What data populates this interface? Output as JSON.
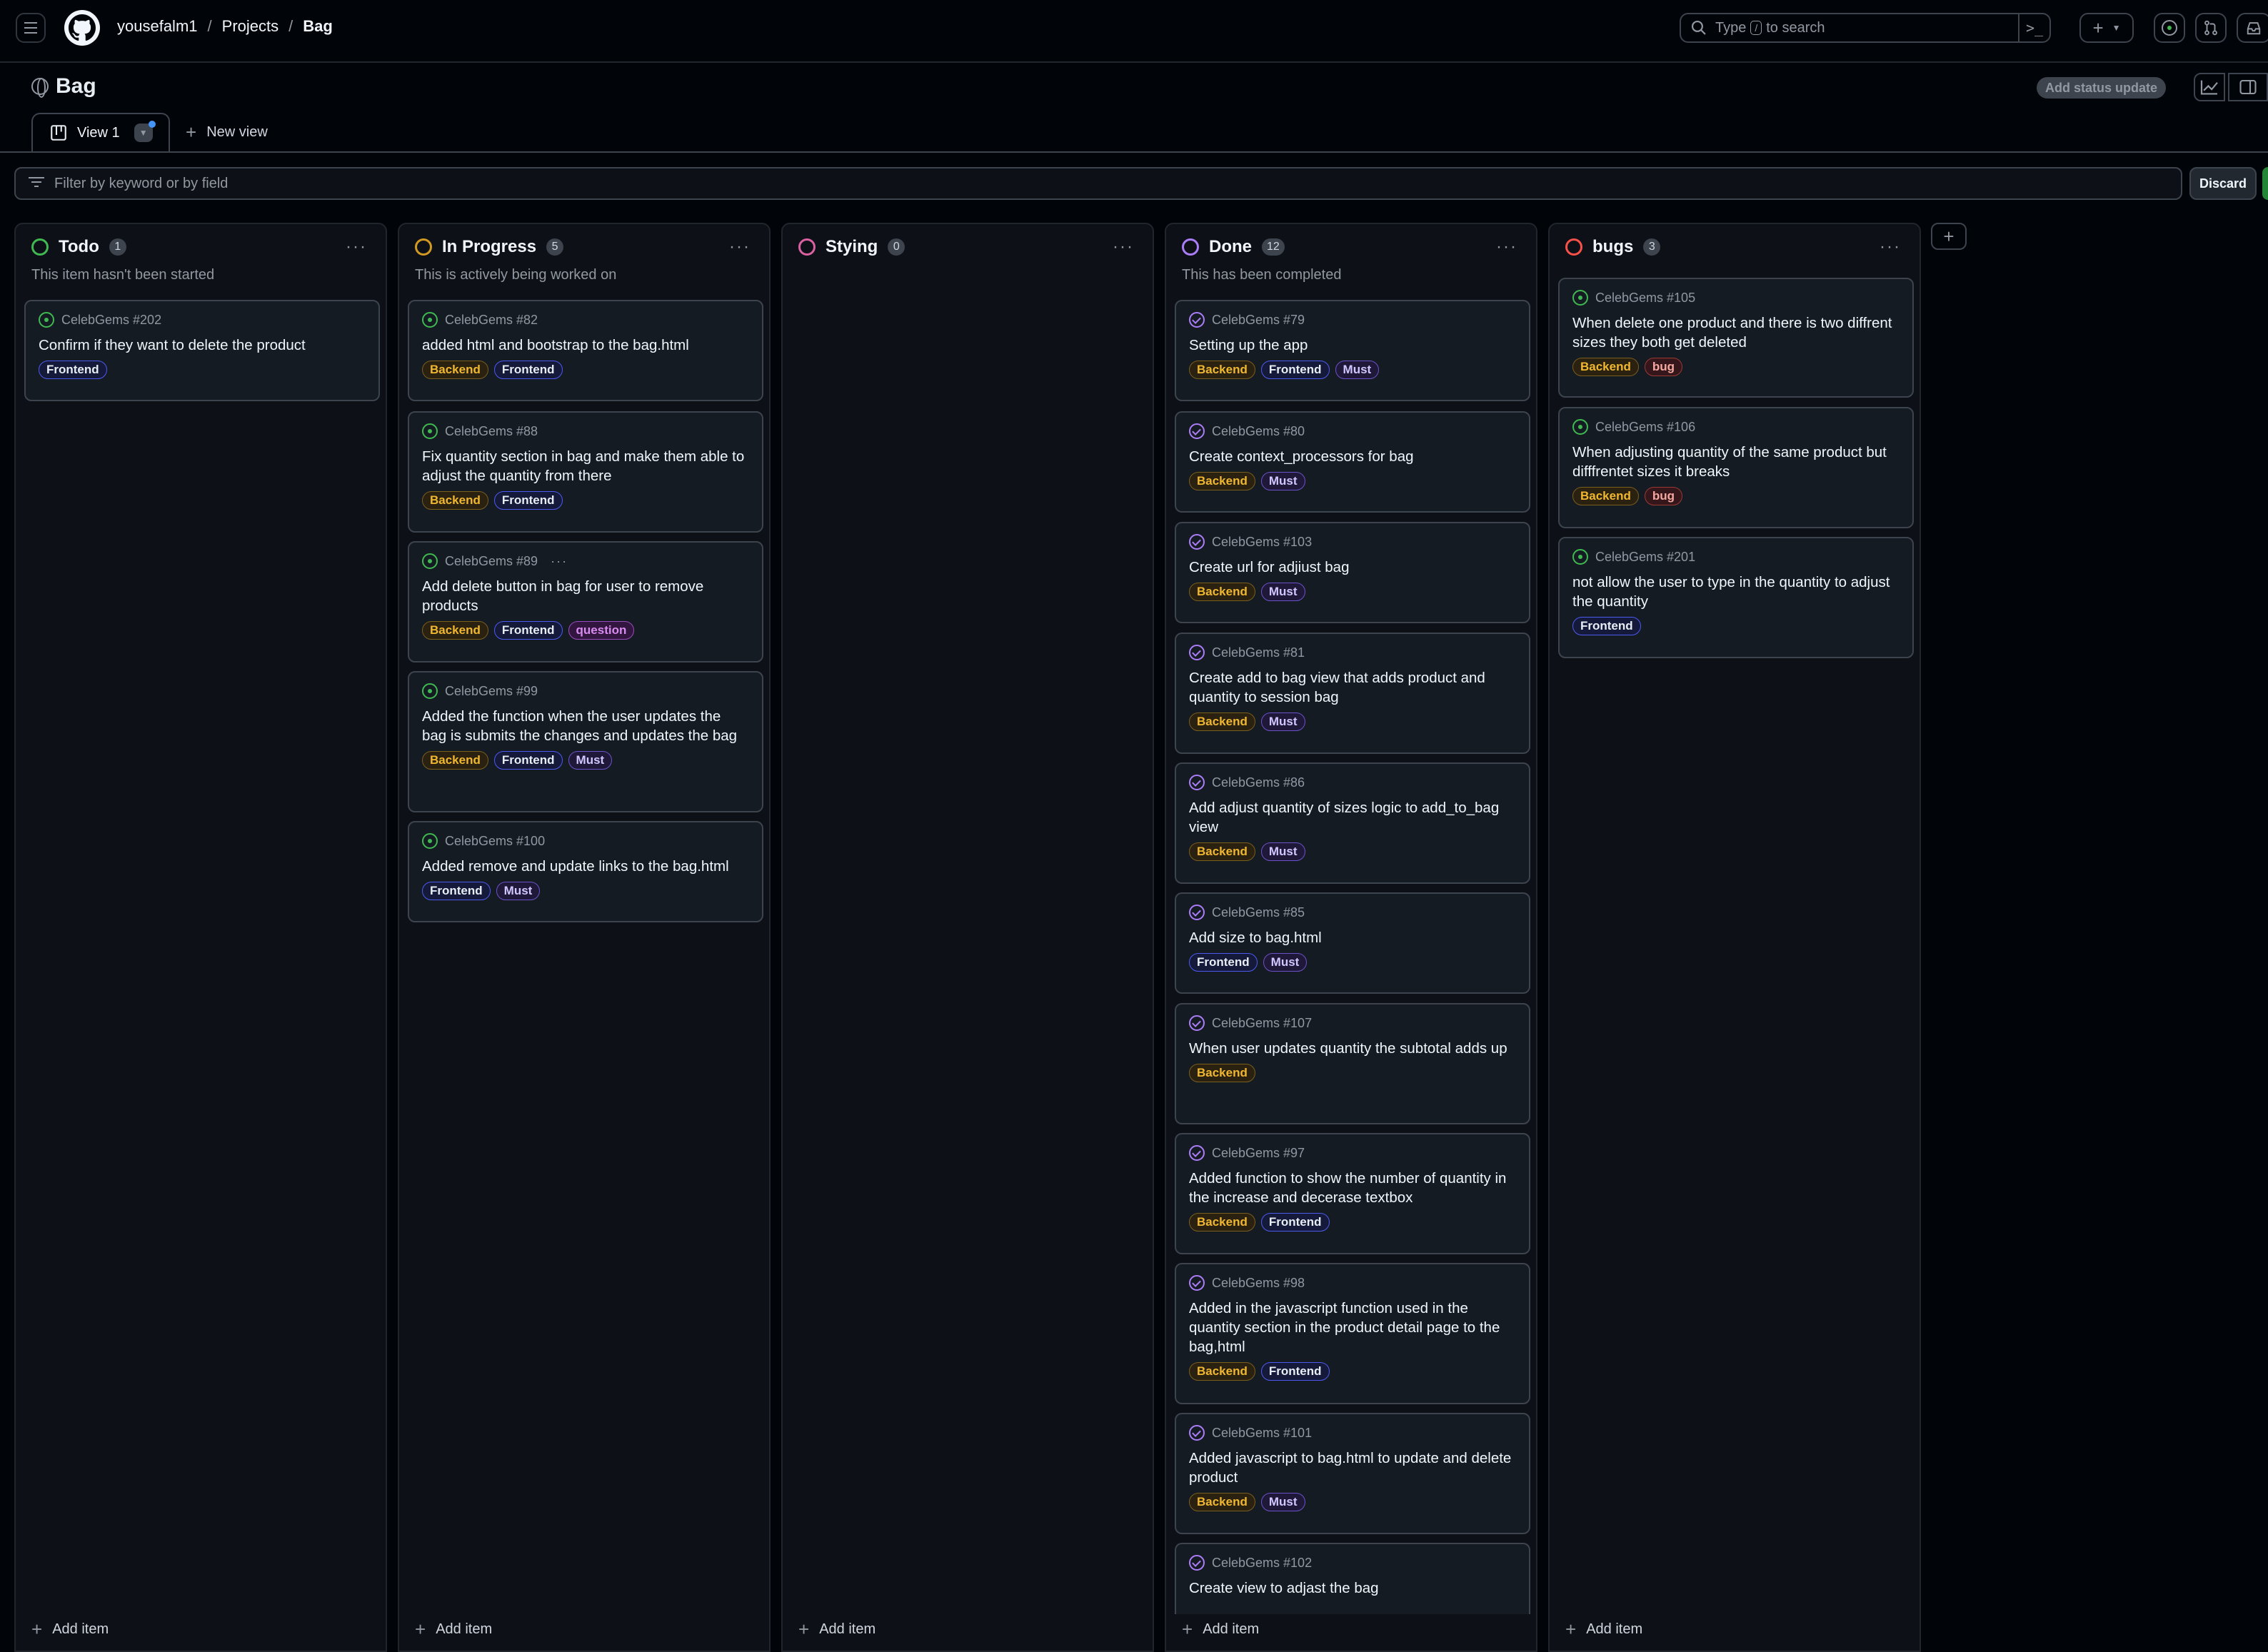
{
  "header": {
    "breadcrumbs": [
      "yousefalm1",
      "Projects",
      "Bag"
    ],
    "search_placeholder_pre": "Type",
    "search_kbd": "/",
    "search_placeholder_post": "to search"
  },
  "project": {
    "title": "Bag",
    "status_button": "Add status update"
  },
  "tabs": {
    "active": "View 1",
    "new_view": "New view"
  },
  "filter": {
    "placeholder": "Filter by keyword or by field",
    "discard": "Discard"
  },
  "columns": [
    {
      "name": "Todo",
      "count": "1",
      "description": "This item hasn't been started",
      "color": "#3fb950",
      "add_item": "Add item",
      "cards": [
        {
          "ref": "CelebGems #202",
          "title": "Confirm if they want to delete the product",
          "labels": [
            "Frontend"
          ],
          "state": "open"
        }
      ]
    },
    {
      "name": "In Progress",
      "count": "5",
      "description": "This is actively being worked on",
      "color": "#d29922",
      "add_item": "Add item",
      "cards": [
        {
          "ref": "CelebGems #82",
          "title": "added html and bootstrap to the bag.html",
          "labels": [
            "Backend",
            "Frontend"
          ],
          "state": "open"
        },
        {
          "ref": "CelebGems #88",
          "title": "Fix quantity section in bag and make them able to adjust the quantity from there",
          "labels": [
            "Backend",
            "Frontend"
          ],
          "state": "open"
        },
        {
          "ref": "CelebGems #89",
          "title": "Add delete button in bag for user to remove products",
          "labels": [
            "Backend",
            "Frontend",
            "question"
          ],
          "state": "open"
        },
        {
          "ref": "CelebGems #99",
          "title": "Added the function when the user updates the bag is submits the changes and updates the bag",
          "labels": [
            "Backend",
            "Frontend",
            "Must"
          ],
          "state": "open"
        },
        {
          "ref": "CelebGems #100",
          "title": "Added remove and update links to the bag.html",
          "labels": [
            "Frontend",
            "Must"
          ],
          "state": "open"
        }
      ]
    },
    {
      "name": "Stying",
      "count": "0",
      "description": "",
      "color": "#db61a2",
      "add_item": "Add item",
      "cards": []
    },
    {
      "name": "Done",
      "count": "12",
      "description": "This has been completed",
      "color": "#ab7df8",
      "add_item": "Add item",
      "cards": [
        {
          "ref": "CelebGems #79",
          "title": "Setting up the app",
          "labels": [
            "Backend",
            "Frontend",
            "Must"
          ],
          "state": "closed"
        },
        {
          "ref": "CelebGems #80",
          "title": "Create context_processors for bag",
          "labels": [
            "Backend",
            "Must"
          ],
          "state": "closed"
        },
        {
          "ref": "CelebGems #103",
          "title": "Create url for adjiust bag",
          "labels": [
            "Backend",
            "Must"
          ],
          "state": "closed"
        },
        {
          "ref": "CelebGems #81",
          "title": "Create add to bag view that adds product and quantity to session bag",
          "labels": [
            "Backend",
            "Must"
          ],
          "state": "closed"
        },
        {
          "ref": "CelebGems #86",
          "title": "Add adjust quantity of sizes logic to add_to_bag view",
          "labels": [
            "Backend",
            "Must"
          ],
          "state": "closed"
        },
        {
          "ref": "CelebGems #85",
          "title": "Add size to bag.html",
          "labels": [
            "Frontend",
            "Must"
          ],
          "state": "closed"
        },
        {
          "ref": "CelebGems #107",
          "title": "When user updates quantity the subtotal adds up",
          "labels": [
            "Backend"
          ],
          "state": "closed"
        },
        {
          "ref": "CelebGems #97",
          "title": "Added function to show the number of quantity in the increase and decerase textbox",
          "labels": [
            "Backend",
            "Frontend"
          ],
          "state": "closed"
        },
        {
          "ref": "CelebGems #98",
          "title": "Added in the javascript function used in the quantity section in the product detail page to the bag,html",
          "labels": [
            "Backend",
            "Frontend"
          ],
          "state": "closed"
        },
        {
          "ref": "CelebGems #101",
          "title": "Added javascript to bag.html to update and delete product",
          "labels": [
            "Backend",
            "Must"
          ],
          "state": "closed"
        },
        {
          "ref": "CelebGems #102",
          "title": "Create view to adjast the bag",
          "labels": [],
          "state": "closed"
        }
      ]
    },
    {
      "name": "bugs",
      "count": "3",
      "description": "",
      "color": "#f85149",
      "add_item": "Add item",
      "cards": [
        {
          "ref": "CelebGems #105",
          "title": "When delete one product and there is two diffrent sizes they both get deleted",
          "labels": [
            "Backend",
            "bug"
          ],
          "state": "open"
        },
        {
          "ref": "CelebGems #106",
          "title": "When adjusting quantity of the same product but difffrentet sizes it breaks",
          "labels": [
            "Backend",
            "bug"
          ],
          "state": "open"
        },
        {
          "ref": "CelebGems #201",
          "title": "not allow the user to type in the quantity to adjust the quantity",
          "labels": [
            "Frontend"
          ],
          "state": "open"
        }
      ]
    }
  ]
}
